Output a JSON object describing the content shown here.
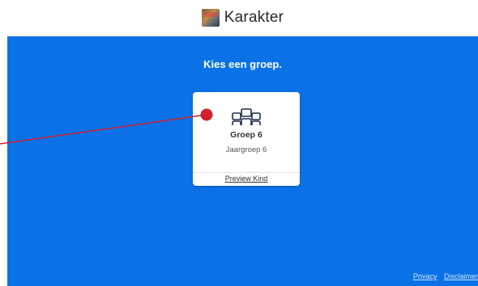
{
  "header": {
    "title": "Karakter",
    "logo_icon": "karakter-logo-icon"
  },
  "main": {
    "prompt": "Kies een groep.",
    "background": "#0a72e6",
    "groups": [
      {
        "icon": "group-people-icon",
        "name": "Groep 6",
        "subtitle": "Jaargroep 6",
        "link": "Preview Kind"
      }
    ]
  },
  "footer": {
    "privacy": "Privacy",
    "disclaimer": "Disclaimer"
  },
  "annotation": {
    "marker_color": "#d0202e"
  }
}
